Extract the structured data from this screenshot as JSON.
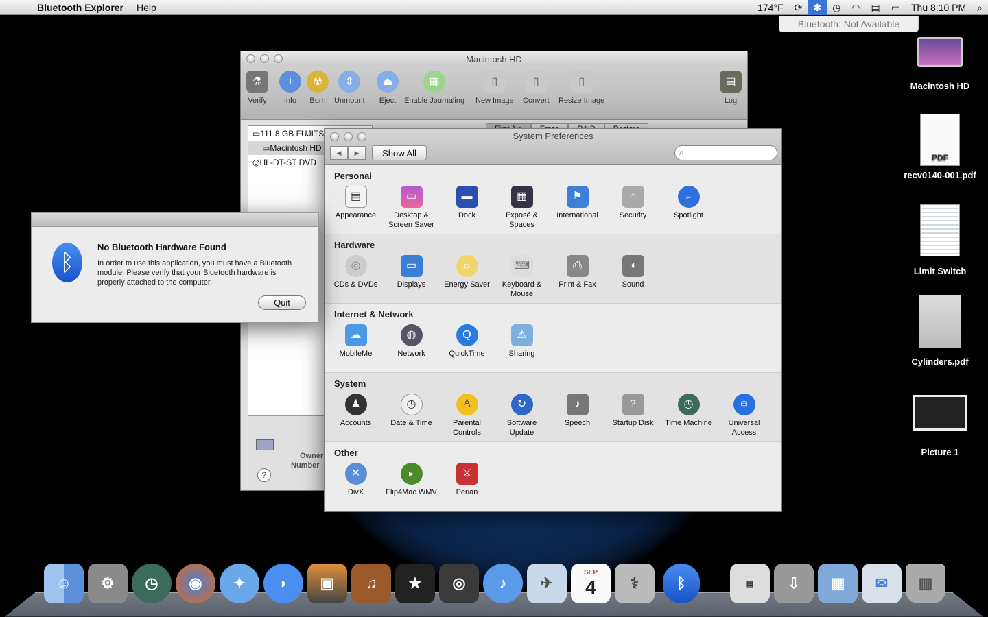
{
  "menubar": {
    "app_name": "Bluetooth Explorer",
    "menus": [
      "Help"
    ],
    "temperature": "174°F",
    "clock": "Thu 8:10 PM"
  },
  "bluetooth_tip": "Bluetooth: Not Available",
  "disk_utility": {
    "title": "Macintosh HD",
    "toolbar": [
      "Verify",
      "Info",
      "Burn",
      "Unmount",
      "Eject",
      "Enable Journaling",
      "New Image",
      "Convert",
      "Resize Image",
      "Log"
    ],
    "devices": [
      "111.8 GB FUJITSU",
      "Macintosh HD",
      "HL-DT-ST DVD"
    ],
    "tabs": [
      "First Aid",
      "Erase",
      "RAID",
      "Restore"
    ],
    "footer": [
      "Owner",
      "Number"
    ]
  },
  "system_prefs": {
    "title": "System Preferences",
    "show_all": "Show All",
    "sections": [
      {
        "name": "Personal",
        "panes": [
          "Appearance",
          "Desktop & Screen Saver",
          "Dock",
          "Exposé & Spaces",
          "International",
          "Security",
          "Spotlight"
        ]
      },
      {
        "name": "Hardware",
        "panes": [
          "CDs & DVDs",
          "Displays",
          "Energy Saver",
          "Keyboard & Mouse",
          "Print & Fax",
          "Sound"
        ]
      },
      {
        "name": "Internet & Network",
        "panes": [
          "MobileMe",
          "Network",
          "QuickTime",
          "Sharing"
        ]
      },
      {
        "name": "System",
        "panes": [
          "Accounts",
          "Date & Time",
          "Parental Controls",
          "Software Update",
          "Speech",
          "Startup Disk",
          "Time Machine",
          "Universal Access"
        ]
      },
      {
        "name": "Other",
        "panes": [
          "DivX",
          "Flip4Mac WMV",
          "Perian"
        ]
      }
    ]
  },
  "alert": {
    "title": "No Bluetooth Hardware Found",
    "message": "In order to use this application, you must have a Bluetooth module.  Please verify that your Bluetooth hardware is properly attached to the computer.",
    "button": "Quit"
  },
  "desktop_icons": [
    "Macintosh HD",
    "recv0140-001.pdf",
    "Limit Switch",
    "Cylinders.pdf",
    "Picture 1"
  ],
  "pdf_badge": "PDF",
  "dock": [
    "Finder",
    "System Preferences",
    "Time Machine",
    "Firefox",
    "Safari",
    "iChat",
    "iPhoto",
    "GarageBand",
    "iMovie",
    "Logic",
    "iTunes",
    "Preview",
    "iCal",
    "Disk Utility",
    "Bluetooth",
    "Womack",
    "Downloads",
    "Documents",
    "Mail",
    "Trash"
  ],
  "ical_month": "SEP",
  "ical_day": "4",
  "colors": {
    "accent": "#3875d7",
    "bluetooth": "#1652c9"
  }
}
